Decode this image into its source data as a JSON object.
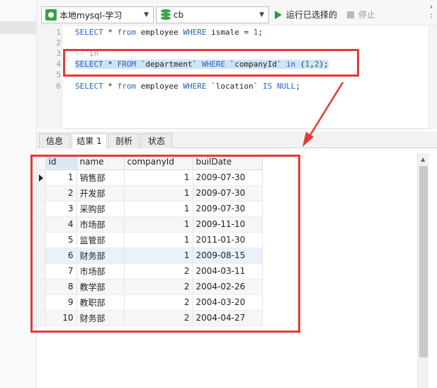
{
  "toolbar": {
    "connection_value": "本地mysql-学习",
    "database_value": "cb",
    "run_selected_label": "运行已选择的",
    "stop_label": "停止"
  },
  "editor": {
    "lines": [
      {
        "num": "1"
      },
      {
        "num": "2"
      },
      {
        "num": "3"
      },
      {
        "num": "4"
      },
      {
        "num": "5"
      },
      {
        "num": "6"
      }
    ],
    "line1": {
      "p1": "SELECT",
      "p2": " * ",
      "p3": "from",
      "p4": " employee ",
      "p5": "WHERE",
      "p6": " ismale = ",
      "p7": "1",
      "p8": ";"
    },
    "line3": {
      "comment": "-- in"
    },
    "line4": {
      "p1": "SELECT",
      "p2": " * ",
      "p3": "FROM",
      "p4": " `department` ",
      "p5": "WHERE",
      "p6": " `companyId` ",
      "p7": "in",
      "p8": " (",
      "p9": "1",
      "p10": ",",
      "p11": "2",
      "p12": ");"
    },
    "line6": {
      "p1": "SELECT",
      "p2": " * ",
      "p3": "from",
      "p4": " employee ",
      "p5": "WHERE",
      "p6": " `location` ",
      "p7": "IS",
      "p8": " ",
      "p9": "NULL",
      "p10": ";"
    }
  },
  "tabs": [
    "信息",
    "结果 1",
    "剖析",
    "状态"
  ],
  "result": {
    "columns": [
      "id",
      "name",
      "companyId",
      "builDate"
    ],
    "rows": [
      [
        "1",
        "销售部",
        "1",
        "2009-07-30"
      ],
      [
        "2",
        "开发部",
        "1",
        "2009-07-30"
      ],
      [
        "3",
        "采购部",
        "1",
        "2009-07-30"
      ],
      [
        "4",
        "市场部",
        "1",
        "2009-11-10"
      ],
      [
        "5",
        "监管部",
        "1",
        "2011-01-30"
      ],
      [
        "6",
        "财务部",
        "1",
        "2009-08-15"
      ],
      [
        "7",
        "市场部",
        "2",
        "2004-03-11"
      ],
      [
        "8",
        "教学部",
        "2",
        "2004-02-26"
      ],
      [
        "9",
        "教职部",
        "2",
        "2004-03-20"
      ],
      [
        "10",
        "财务部",
        "2",
        "2004-04-27"
      ]
    ]
  },
  "colors": {
    "annotation": "#e53935",
    "keyword": "#2a64c4",
    "selection": "#cfe3f7",
    "run_icon": "#2f9a3c"
  }
}
